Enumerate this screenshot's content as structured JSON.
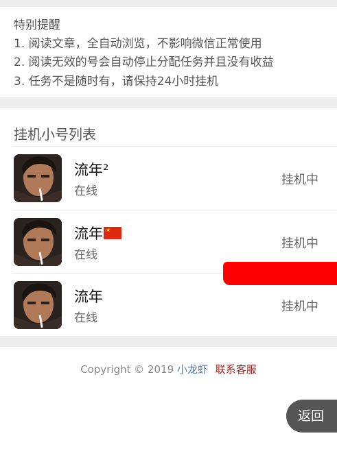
{
  "notice": {
    "title": "特别提醒",
    "lines": [
      "1. 阅读文章，全自动浏览，不影响微信正常使用",
      "2. 阅读无效的号会自动停止分配任务并且没有收益",
      "3. 任务不是随时有，请保持24小时挂机"
    ]
  },
  "account_list": {
    "title": "挂机小号列表",
    "accounts": [
      {
        "name": "流年²",
        "status": "在线",
        "state": "挂机中"
      },
      {
        "name": "流年",
        "status": "在线",
        "state": "挂机中",
        "flag": "china-flag-icon"
      },
      {
        "name": "流年",
        "status": "在线",
        "state": "挂机中"
      }
    ]
  },
  "footer": {
    "copyright": "Copyright © 2019",
    "brand": "小龙虾",
    "contact": "联系客服"
  },
  "back_button": "返回",
  "colors": {
    "page_bg": "#ededed",
    "brand": "#4a7ab0",
    "contact": "#a02020",
    "redaction": "#ff0000",
    "back_button_bg": "#555555"
  }
}
